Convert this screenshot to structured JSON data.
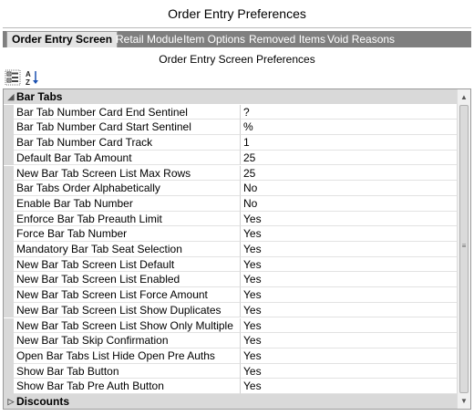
{
  "window": {
    "title": "Order Entry Preferences"
  },
  "tabs": [
    {
      "label": "Order Entry Screen",
      "active": true
    },
    {
      "label": "Retail Module",
      "active": false
    },
    {
      "label": "Item Options",
      "active": false
    },
    {
      "label": "Removed Items",
      "active": false
    },
    {
      "label": "Void Reasons",
      "active": false
    }
  ],
  "panel": {
    "title": "Order Entry Screen Preferences"
  },
  "toolbar": {
    "categorized_icon": "categorized-view-icon",
    "sort_icon": "alphabetical-sort-icon",
    "sort_glyph_top": "A",
    "sort_glyph_bottom": "Z"
  },
  "grid": {
    "categories": [
      {
        "name": "Bar Tabs",
        "expanded": true,
        "glyph": "◢",
        "properties": [
          {
            "label": "Bar Tab Number Card End Sentinel",
            "value": "?"
          },
          {
            "label": "Bar Tab Number Card Start Sentinel",
            "value": "%"
          },
          {
            "label": "Bar Tab Number Card Track",
            "value": "1"
          },
          {
            "label": "Default Bar Tab Amount",
            "value": "25"
          },
          {
            "label": "New Bar Tab Screen List Max Rows",
            "value": "25"
          },
          {
            "label": "Bar Tabs Order Alphabetically",
            "value": "No"
          },
          {
            "label": "Enable Bar Tab Number",
            "value": "No"
          },
          {
            "label": "Enforce Bar Tab Preauth Limit",
            "value": "Yes"
          },
          {
            "label": "Force Bar Tab Number",
            "value": "Yes"
          },
          {
            "label": "Mandatory Bar Tab Seat Selection",
            "value": "Yes"
          },
          {
            "label": "New Bar Tab Screen List Default",
            "value": "Yes"
          },
          {
            "label": "New Bar Tab Screen List Enabled",
            "value": "Yes"
          },
          {
            "label": "New Bar Tab Screen List Force Amount",
            "value": "Yes"
          },
          {
            "label": "New Bar Tab Screen List Show Duplicates",
            "value": "Yes"
          },
          {
            "label": "New Bar Tab Screen List Show Only Multiple",
            "value": "Yes"
          },
          {
            "label": "New Bar Tab Skip Confirmation",
            "value": "Yes"
          },
          {
            "label": "Open Bar Tabs List Hide Open Pre Auths",
            "value": "Yes"
          },
          {
            "label": "Show Bar Tab Button",
            "value": "Yes"
          },
          {
            "label": "Show Bar Tab Pre Auth Button",
            "value": "Yes"
          }
        ]
      },
      {
        "name": "Discounts",
        "expanded": false,
        "glyph": "▷",
        "properties": []
      }
    ]
  },
  "scrollbar": {
    "up": "▲",
    "down": "▼",
    "grip": "≡"
  },
  "colors": {
    "tabstrip": "#7f7f7f",
    "active_tab": "#e4e4e4",
    "category_bg": "#d9d9d9"
  }
}
